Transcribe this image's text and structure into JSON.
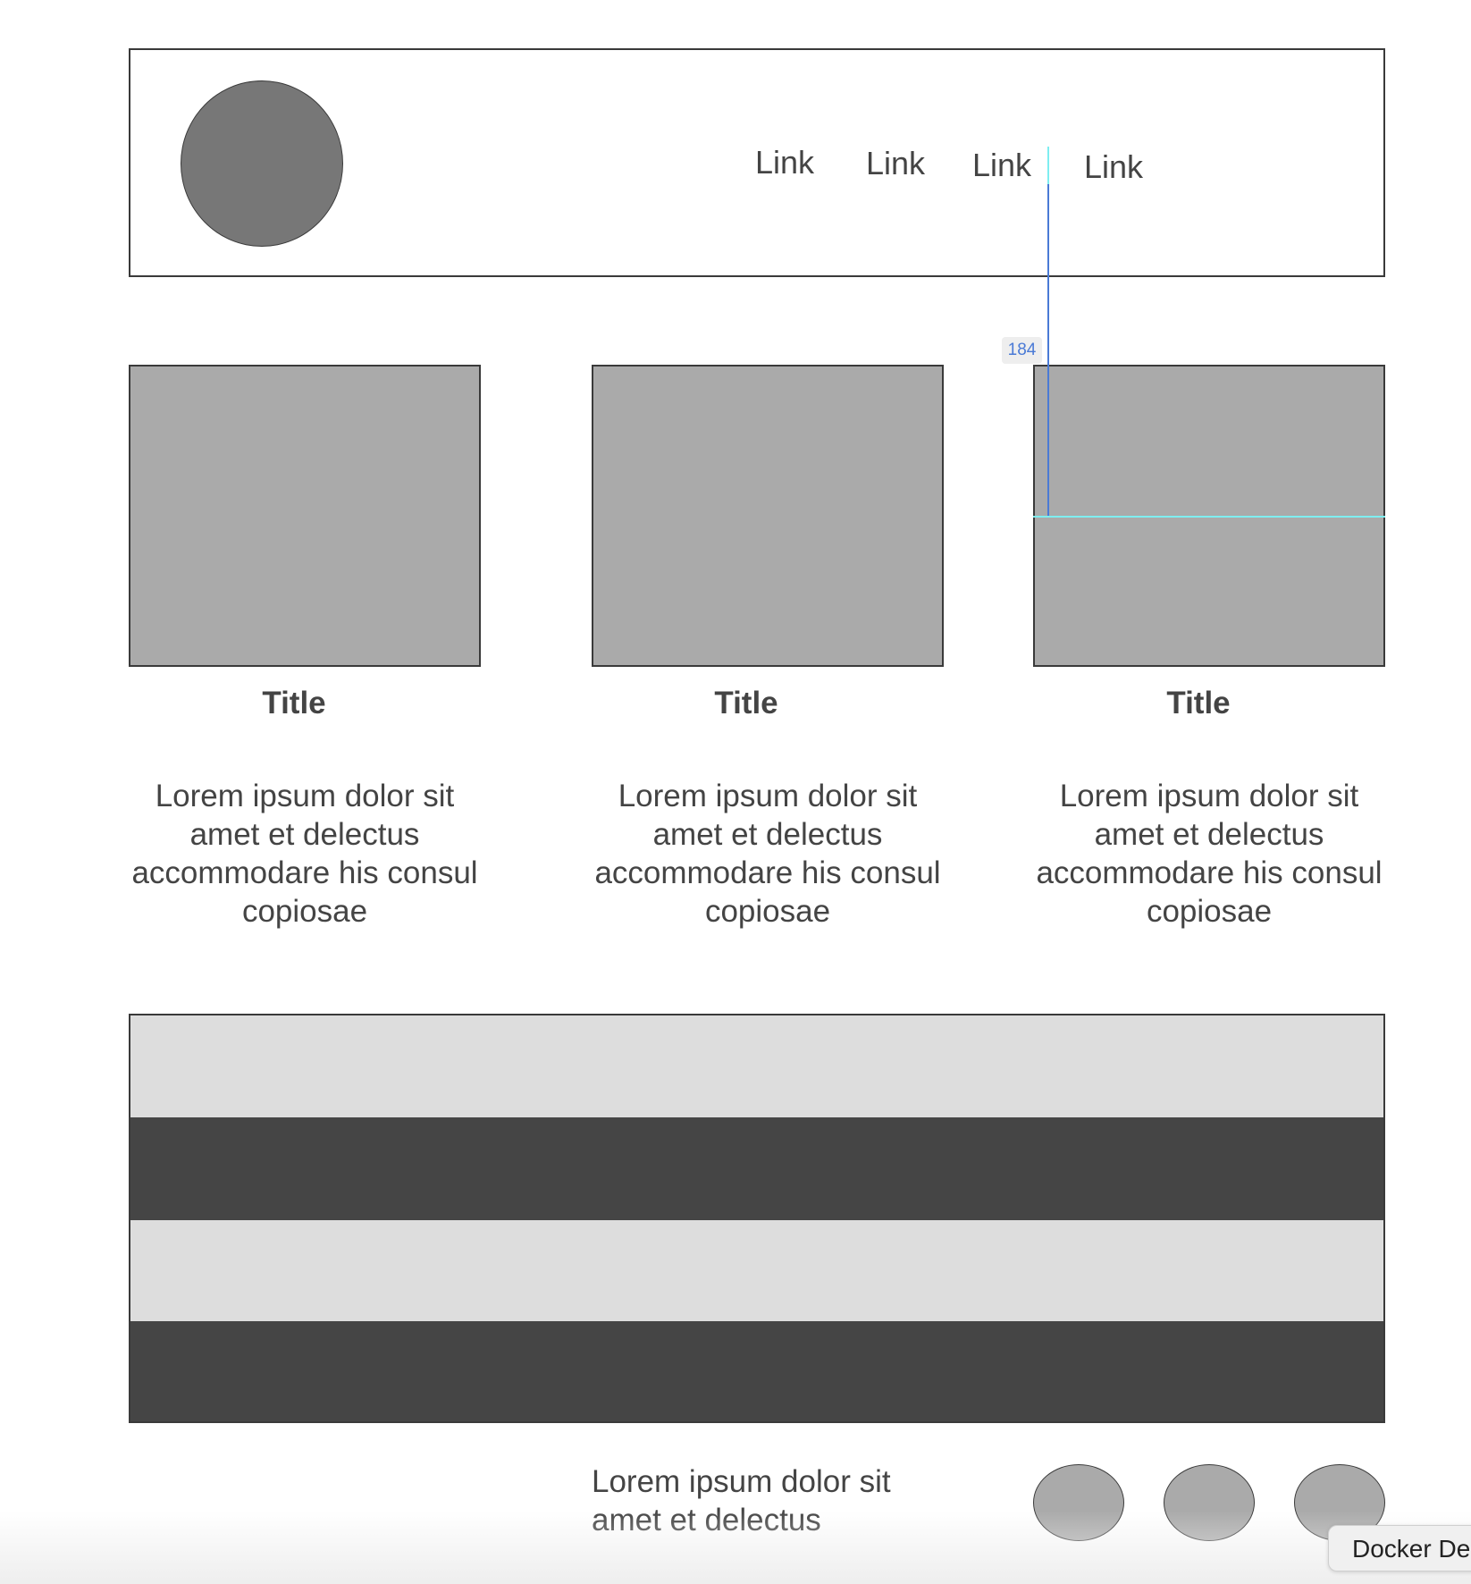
{
  "header": {
    "nav_links": [
      "Link",
      "Link",
      "Link",
      "Link"
    ]
  },
  "cards": [
    {
      "title": "Title",
      "body": "Lorem ipsum dolor sit amet et delectus accommodare his consul copiosae"
    },
    {
      "title": "Title",
      "body": "Lorem ipsum dolor sit amet et delectus accommodare his consul copiosae"
    },
    {
      "title": "Title",
      "body": "Lorem ipsum dolor sit amet et delectus accommodare his consul copiosae"
    }
  ],
  "measurement": {
    "value": "184"
  },
  "footer": {
    "text": "Lorem ipsum dolor sit amet et delectus"
  },
  "dock": {
    "tooltip": "Docker De"
  },
  "colors": {
    "outline": "#3a3a3a",
    "placeholder_dark": "#777777",
    "placeholder": "#aaaaaa",
    "stripe_light": "#dddddd",
    "stripe_dark": "#454545",
    "guide_blue": "#4a7ad6",
    "guide_cyan": "#7eeef0",
    "text": "#444444"
  }
}
